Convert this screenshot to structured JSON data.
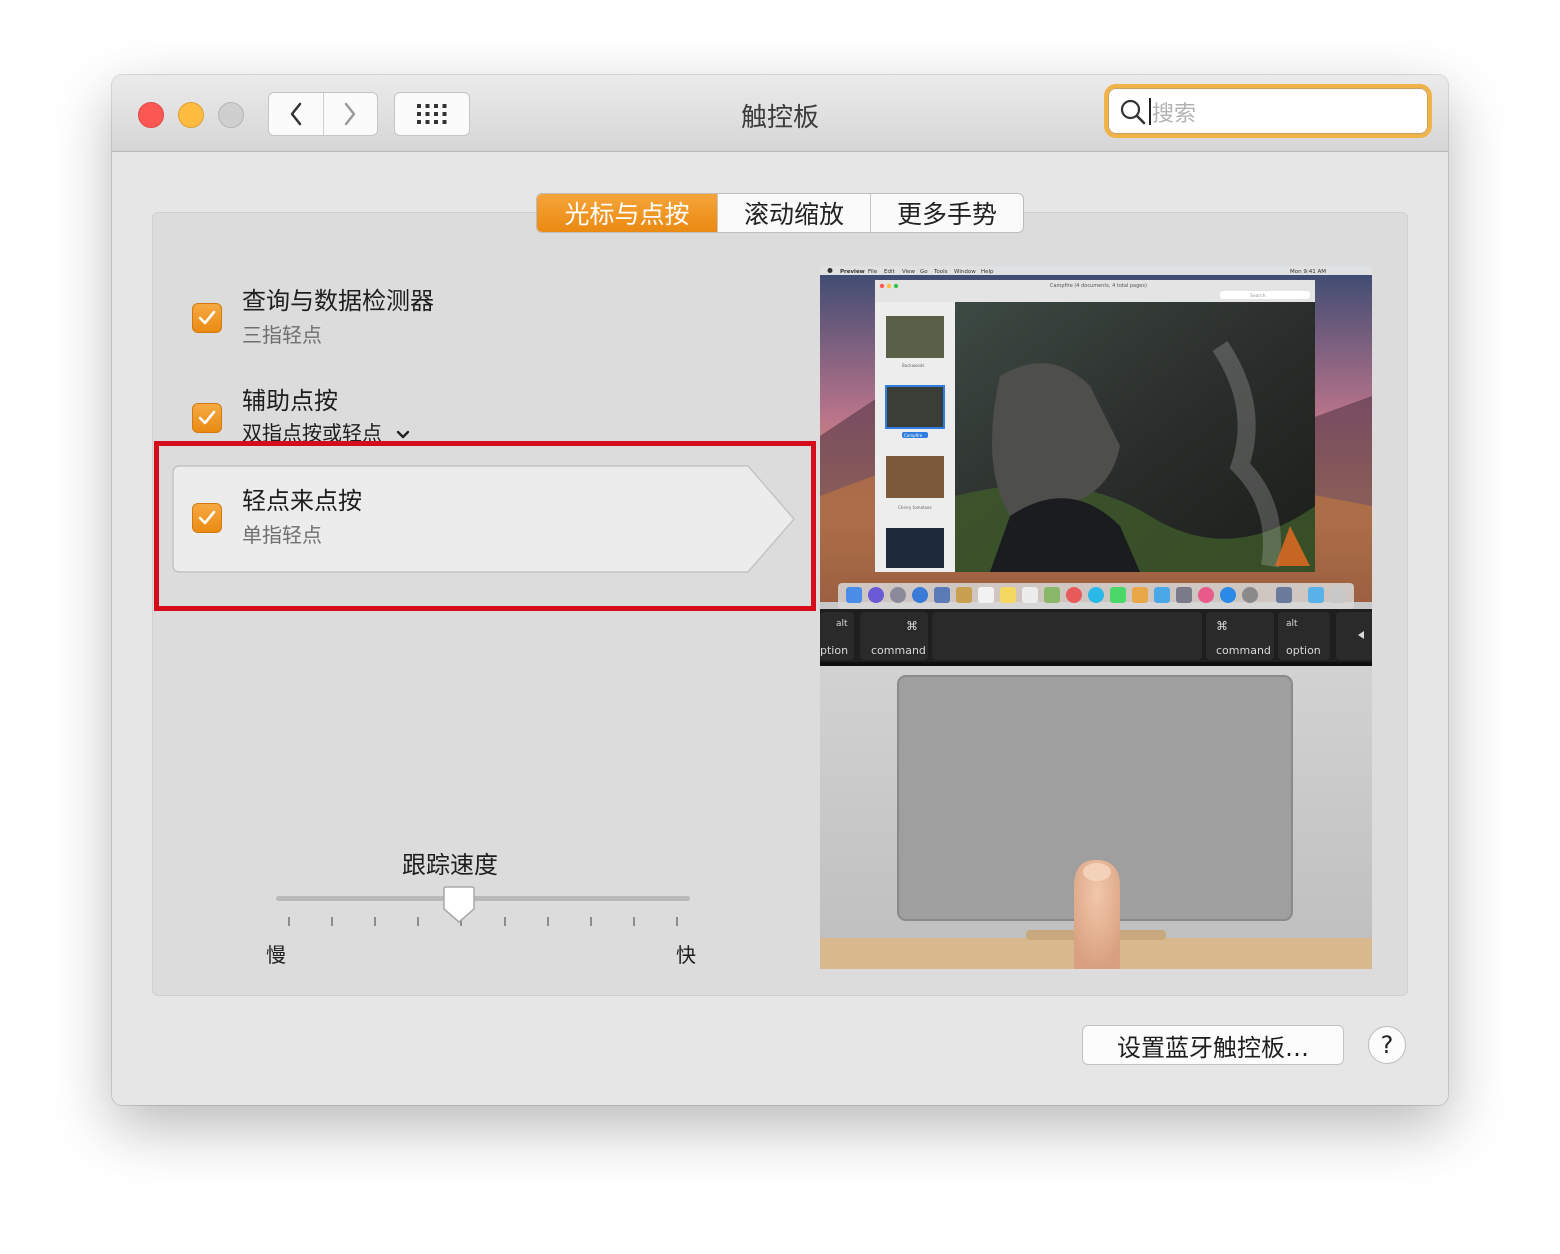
{
  "window": {
    "title": "触控板",
    "search_placeholder": "搜索"
  },
  "tabs": [
    {
      "label": "光标与点按",
      "active": true
    },
    {
      "label": "滚动缩放",
      "active": false
    },
    {
      "label": "更多手势",
      "active": false
    }
  ],
  "options": [
    {
      "title": "查询与数据检测器",
      "subtitle": "三指轻点",
      "checked": true
    },
    {
      "title": "辅助点按",
      "subtitle": "双指点按或轻点",
      "checked": true,
      "has_dropdown": true
    },
    {
      "title": "轻点来点按",
      "subtitle": "单指轻点",
      "checked": true,
      "selected": true
    }
  ],
  "tracking": {
    "label": "跟踪速度",
    "min_label": "慢",
    "max_label": "快",
    "ticks": 10,
    "value": 0.44
  },
  "preview": {
    "menu_items": [
      "Preview",
      "File",
      "Edit",
      "View",
      "Go",
      "Tools",
      "Window",
      "Help"
    ],
    "clock": "Mon 9:41 AM",
    "doc_title": "Campfire (4 documents, 4 total pages)",
    "search_hint": "Search",
    "thumbs": [
      "Backwoods",
      "Campfire",
      "Cherry tomatoes"
    ],
    "keys": {
      "alt": "alt",
      "option": "option",
      "option_cut": "ption",
      "command": "command",
      "cmd_symbol": "⌘"
    }
  },
  "footer": {
    "bluetooth_button": "设置蓝牙触控板…",
    "help": "?"
  },
  "colors": {
    "accent": "#f0a030",
    "highlight": "#d50d1a"
  }
}
